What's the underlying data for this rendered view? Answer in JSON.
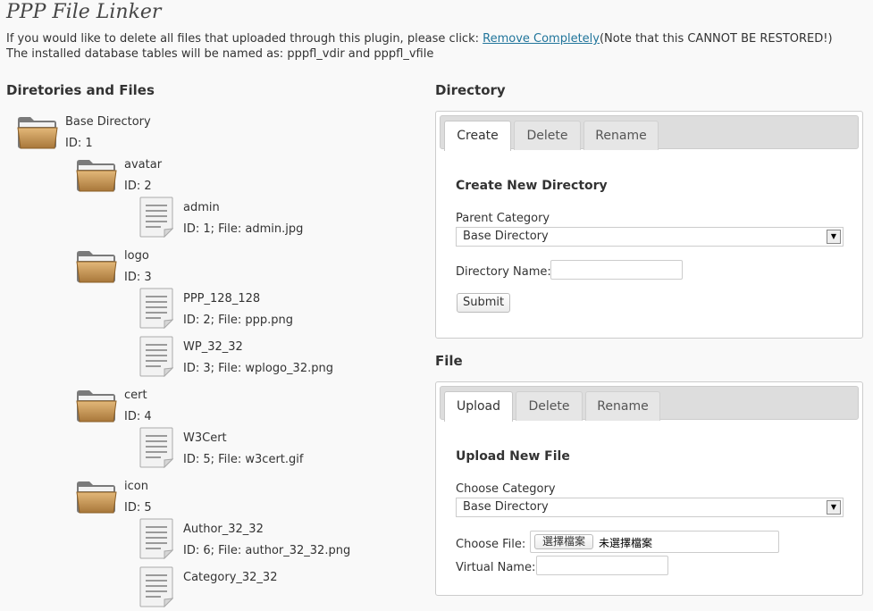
{
  "page": {
    "title": "PPP File Linker",
    "intro_prefix": "If you would like to delete all files that uploaded through this plugin, please click: ",
    "intro_link": "Remove Completely",
    "intro_suffix": "(Note that this CANNOT BE RESTORED!)",
    "intro_line2": "The installed database tables will be named as: pppfl_vdir and pppfl_vfile"
  },
  "tree": {
    "heading": "Diretories and Files",
    "nodes": [
      {
        "type": "folder",
        "name": "Base Directory",
        "meta": "ID: 1"
      },
      {
        "type": "folder",
        "name": "avatar",
        "meta": "ID: 2"
      },
      {
        "type": "file",
        "name": "admin",
        "meta": "ID: 1; File: admin.jpg"
      },
      {
        "type": "folder",
        "name": "logo",
        "meta": "ID: 3"
      },
      {
        "type": "file",
        "name": "PPP_128_128",
        "meta": "ID: 2; File: ppp.png"
      },
      {
        "type": "file",
        "name": "WP_32_32",
        "meta": "ID: 3; File: wplogo_32.png"
      },
      {
        "type": "folder",
        "name": "cert",
        "meta": "ID: 4"
      },
      {
        "type": "file",
        "name": "W3Cert",
        "meta": "ID: 5; File: w3cert.gif"
      },
      {
        "type": "folder",
        "name": "icon",
        "meta": "ID: 5"
      },
      {
        "type": "file",
        "name": "Author_32_32",
        "meta": "ID: 6; File: author_32_32.png"
      },
      {
        "type": "file",
        "name": "Category_32_32",
        "meta": ""
      }
    ]
  },
  "directory": {
    "heading": "Directory",
    "tabs": [
      "Create",
      "Delete",
      "Rename"
    ],
    "panel_title": "Create New Directory",
    "parent_label": "Parent Category",
    "parent_value": "Base Directory",
    "name_label": "Directory Name:",
    "name_value": "",
    "submit": "Submit"
  },
  "file": {
    "heading": "File",
    "tabs": [
      "Upload",
      "Delete",
      "Rename"
    ],
    "panel_title": "Upload New File",
    "category_label": "Choose Category",
    "category_value": "Base Directory",
    "choose_label": "Choose File:",
    "choose_button": "選擇檔案",
    "no_file": "未選擇檔案",
    "virtual_label": "Virtual Name:",
    "virtual_value": ""
  },
  "colors": {
    "link": "#21759b",
    "folder": "#c99a55",
    "background": "#f9f9f9"
  }
}
